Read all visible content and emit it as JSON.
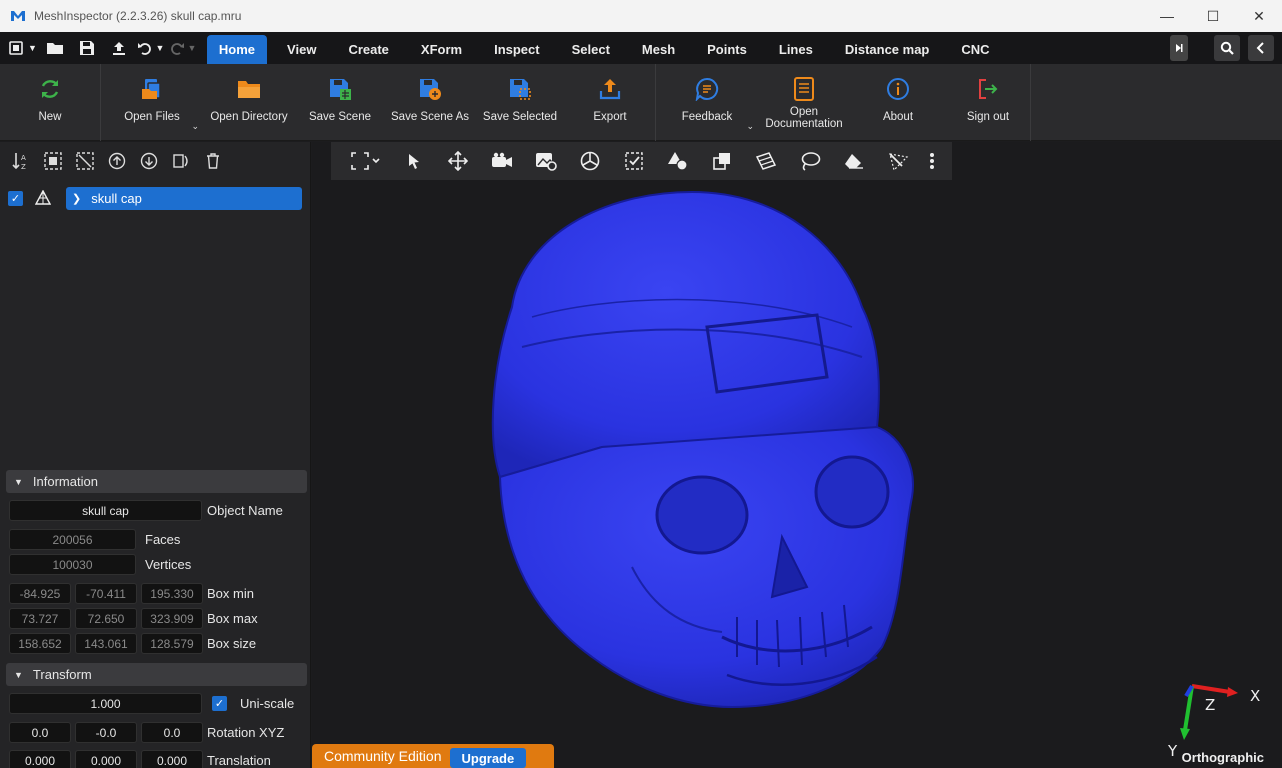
{
  "window": {
    "title": "MeshInspector (2.2.3.26) skull cap.mru"
  },
  "tabs": [
    "Home",
    "View",
    "Create",
    "XForm",
    "Inspect",
    "Select",
    "Mesh",
    "Points",
    "Lines",
    "Distance map",
    "CNC"
  ],
  "active_tab": "Home",
  "ribbon": {
    "new": "New",
    "open_files": "Open Files",
    "open_directory": "Open Directory",
    "save_scene": "Save Scene",
    "save_scene_as": "Save Scene As",
    "save_selected": "Save Selected",
    "export": "Export",
    "feedback": "Feedback",
    "open_documentation_1": "Open",
    "open_documentation_2": "Documentation",
    "about": "About",
    "sign_out": "Sign out"
  },
  "scene_tree": {
    "object_name": "skull cap"
  },
  "information": {
    "header": "Information",
    "object_name_value": "skull cap",
    "object_name_label": "Object Name",
    "faces": "200056",
    "faces_label": "Faces",
    "vertices": "100030",
    "vertices_label": "Vertices",
    "box_min": [
      "-84.925",
      "-70.411",
      "195.330"
    ],
    "box_min_label": "Box min",
    "box_max": [
      "73.727",
      "72.650",
      "323.909"
    ],
    "box_max_label": "Box max",
    "box_size": [
      "158.652",
      "143.061",
      "128.579"
    ],
    "box_size_label": "Box size"
  },
  "transform": {
    "header": "Transform",
    "scale": "1.000",
    "uni_scale_label": "Uni-scale",
    "rotation": [
      "0.0",
      "-0.0",
      "0.0"
    ],
    "rotation_label": "Rotation XYZ",
    "translation": [
      "0.000",
      "0.000",
      "0.000"
    ],
    "translation_label": "Translation"
  },
  "viewport": {
    "projection": "Orthographic",
    "axis_x": "X",
    "axis_y": "Y",
    "axis_z": "Z",
    "mesh_color": "#2a33e0"
  },
  "footer": {
    "edition": "Community Edition",
    "upgrade": "Upgrade"
  },
  "colors": {
    "accent": "#1d6fd0",
    "edition_orange": "#e07a10"
  }
}
